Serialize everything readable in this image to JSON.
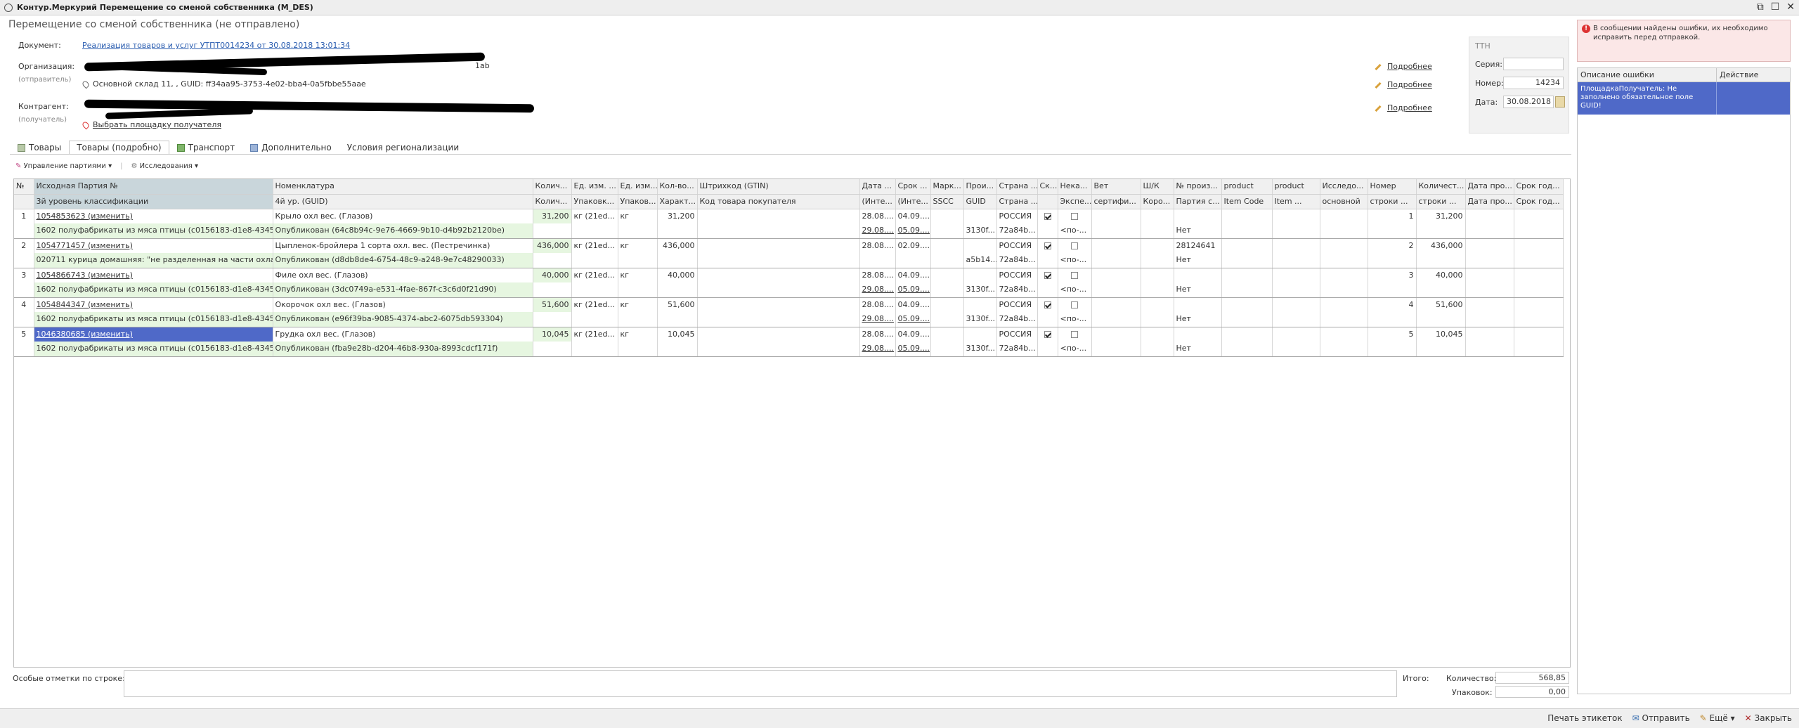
{
  "window": {
    "title": "Контур.Меркурий Перемещение со сменой собственника (M_DES)",
    "controls": [
      "⧉",
      "☐",
      "✕"
    ]
  },
  "page_title": "Перемещение со сменой собственника (не отправлено)",
  "header": {
    "document_label": "Документ:",
    "document_link": "Реализация товаров и услуг УТПТ0014234 от 30.08.2018 13:01:34",
    "org_label": "Организация:",
    "org_sub": "(отправитель)",
    "org_tail": "1ab",
    "org_warehouse": "Основной склад 11, , GUID: ff34aa95-3753-4e02-bba4-0a5fbbe55aae",
    "contr_label": "Контрагент:",
    "contr_sub": "(получатель)",
    "choose_site": "Выбрать площадку получателя",
    "more": [
      "Подробнее",
      "Подробнее",
      "Подробнее"
    ]
  },
  "ttn": {
    "title": "ТТН",
    "series_label": "Серия:",
    "series_value": "",
    "number_label": "Номер:",
    "number_value": "14234",
    "date_label": "Дата:",
    "date_value": "30.08.2018"
  },
  "error": {
    "message": "В сообщении найдены ошибки, их необходимо исправить перед отправкой.",
    "col_desc": "Описание ошибки",
    "col_action": "Действие",
    "row_desc": "ПлощадкаПолучатель: Не заполнено обязательное поле GUID!",
    "row_action": ""
  },
  "tabs": [
    "Товары",
    "Товары (подробно)",
    "Транспорт",
    "Дополнительно",
    "Условия регионализации"
  ],
  "toolbar": {
    "manage": "Управление партиями",
    "research": "Исследования"
  },
  "table": {
    "header1": [
      "№",
      "Исходная Партия №",
      "Номенклатура",
      "Колич...",
      "Ед. изм. ...",
      "Ед. изм...",
      "Кол-во...",
      "Штрихкод (GTIN)",
      "Дата ...",
      "Срок ...",
      "Марк...",
      "Прои...",
      "Страна ...",
      "Ск...",
      "Нека...",
      "Вет",
      "Ш/К",
      "№ произ...",
      "product",
      "product",
      "Исследо...",
      "Номер",
      "Количест...",
      "Дата про...",
      "Срок год..."
    ],
    "header2": [
      "",
      "3й уровень классификации",
      "4й ур. (GUID)",
      "Колич...",
      "Упаковк...",
      "Упаков...",
      "Характ...",
      "Код товара покупателя",
      "(Инте...",
      "(Инте...",
      "SSCC",
      "GUID",
      "Страна ...",
      "",
      "Экспе...",
      "сертифи...",
      "Коро...",
      "Партия с...",
      "Item Code",
      "Item ...",
      "основной",
      "строки ...",
      "строки ...",
      "Дата про...",
      "Срок год..."
    ],
    "rows": [
      {
        "n": "1",
        "batch": "1054853623 (изменить)",
        "name": "Крыло охл вес. (Глазов)",
        "qty": "31,200",
        "unit1": "кг (21ed...",
        "unit2": "кг",
        "qty2": "31,200",
        "date": "28.08....",
        "exp": "04.09....",
        "country": "РОССИЯ",
        "prod_no": "",
        "line_no": "1",
        "line_qty": "31,200",
        "cls": "1602 полуфабрикаты из мяса птицы (c0156183-d1e8-4345-...",
        "pub": "Опубликован (64c8b94c-9e76-4669-9b10-d4b92b2120be)",
        "d2": "29.08....",
        "e2": "05.09....",
        "guid": "3130f...",
        "c2": "72a84b...",
        "exp2": "<по-...",
        "lot": "Нет"
      },
      {
        "n": "2",
        "batch": "1054771457 (изменить)",
        "name": "Цыпленок-бройлера 1 сорта охл. вес. (Пестречинка)",
        "qty": "436,000",
        "unit1": "кг (21ed...",
        "unit2": "кг",
        "qty2": "436,000",
        "date": "28.08....",
        "exp": "02.09....",
        "country": "РОССИЯ",
        "prod_no": "28124641",
        "line_no": "2",
        "line_qty": "436,000",
        "cls": "020711 курица домашняя: \"не разделенная на части охлаж...",
        "pub": "Опубликован (d8db8de4-6754-48c9-a248-9e7c48290033)",
        "d2": "",
        "e2": "",
        "guid": "a5b14...",
        "c2": "72a84b...",
        "exp2": "<по-...",
        "lot": "Нет"
      },
      {
        "n": "3",
        "batch": "1054866743 (изменить)",
        "name": "Филе охл вес. (Глазов)",
        "qty": "40,000",
        "unit1": "кг (21ed...",
        "unit2": "кг",
        "qty2": "40,000",
        "date": "28.08....",
        "exp": "04.09....",
        "country": "РОССИЯ",
        "prod_no": "",
        "line_no": "3",
        "line_qty": "40,000",
        "cls": "1602 полуфабрикаты из мяса птицы (c0156183-d1e8-4345-...",
        "pub": "Опубликован (3dc0749a-e531-4fae-867f-c3c6d0f21d90)",
        "d2": "29.08....",
        "e2": "05.09....",
        "guid": "3130f...",
        "c2": "72a84b...",
        "exp2": "<по-...",
        "lot": "Нет"
      },
      {
        "n": "4",
        "batch": "1054844347 (изменить)",
        "name": "Окорочок охл вес. (Глазов)",
        "qty": "51,600",
        "unit1": "кг (21ed...",
        "unit2": "кг",
        "qty2": "51,600",
        "date": "28.08....",
        "exp": "04.09....",
        "country": "РОССИЯ",
        "prod_no": "",
        "line_no": "4",
        "line_qty": "51,600",
        "cls": "1602 полуфабрикаты из мяса птицы (c0156183-d1e8-4345-...",
        "pub": "Опубликован (e96f39ba-9085-4374-abc2-6075db593304)",
        "d2": "29.08....",
        "e2": "05.09....",
        "guid": "3130f...",
        "c2": "72a84b...",
        "exp2": "<по-...",
        "lot": "Нет"
      },
      {
        "n": "5",
        "batch": "1046380685 (изменить)",
        "name": "Грудка охл вес. (Глазов)",
        "qty": "10,045",
        "unit1": "кг (21ed...",
        "unit2": "кг",
        "qty2": "10,045",
        "date": "28.08....",
        "exp": "04.09....",
        "country": "РОССИЯ",
        "prod_no": "",
        "line_no": "5",
        "line_qty": "10,045",
        "cls": "1602 полуфабрикаты из мяса птицы (c0156183-d1e8-4345-...",
        "pub": "Опубликован (fba9e28b-d204-46b8-930a-8993cdcf171f)",
        "d2": "29.08....",
        "e2": "05.09....",
        "guid": "3130f...",
        "c2": "72a84b...",
        "exp2": "<по-...",
        "lot": "Нет"
      }
    ]
  },
  "bottom": {
    "notes_label": "Особые отметки по строке:",
    "total_label": "Итого:",
    "qty_label": "Количество:",
    "qty_value": "568,85",
    "pack_label": "Упаковок:",
    "pack_value": "0,00"
  },
  "footer": {
    "print": "Печать этикеток",
    "send": "Отправить",
    "more": "Ещё",
    "close": "Закрыть"
  }
}
